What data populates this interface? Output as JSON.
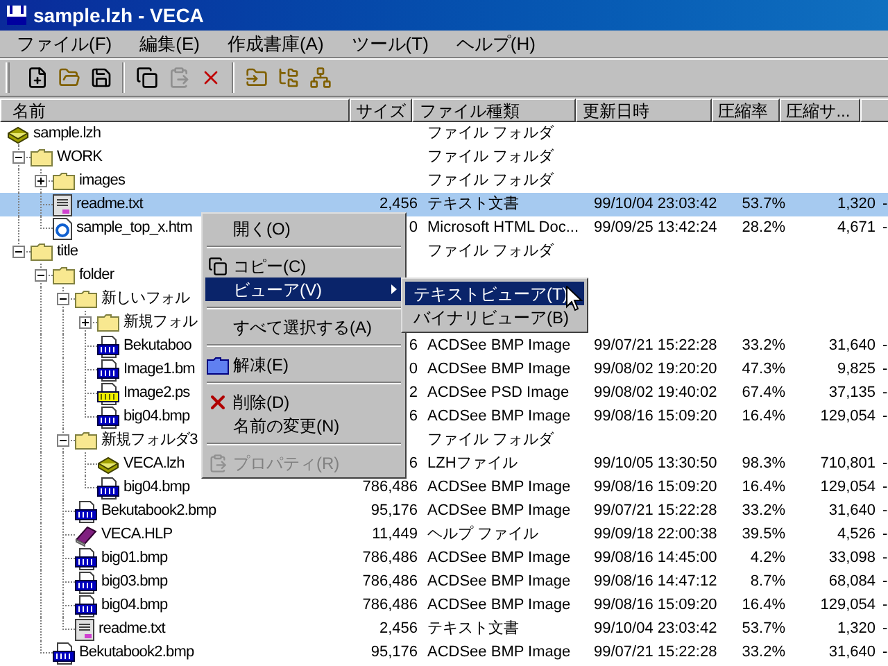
{
  "window": {
    "title": "sample.lzh - VECA"
  },
  "menu_bar": [
    "ファイル(F)",
    "編集(E)",
    "作成書庫(A)",
    "ツール(T)",
    "ヘルプ(H)"
  ],
  "toolbar": [
    {
      "kind": "new",
      "disabled": false
    },
    {
      "kind": "open",
      "disabled": false
    },
    {
      "kind": "save",
      "disabled": false
    },
    {
      "kind": "separator"
    },
    {
      "kind": "copy",
      "disabled": false
    },
    {
      "kind": "paste",
      "disabled": true
    },
    {
      "kind": "delete",
      "disabled": false
    },
    {
      "kind": "separator"
    },
    {
      "kind": "extract",
      "disabled": false
    },
    {
      "kind": "tree",
      "disabled": false
    },
    {
      "kind": "branch",
      "disabled": false
    }
  ],
  "columns": [
    "名前",
    "サイズ",
    "ファイル種類",
    "更新日時",
    "圧縮率",
    "圧縮サ..."
  ],
  "tree": [
    {
      "name": "sample.lzh",
      "kind": "archive",
      "selected": false,
      "type": "ファイル フォルダ",
      "children": [
        {
          "name": "WORK",
          "kind": "folder",
          "expanded": true,
          "selected": false,
          "type": "ファイル フォルダ",
          "children": [
            {
              "name": "images",
              "kind": "folder",
              "expanded": false,
              "selected": false,
              "type": "ファイル フォルダ"
            },
            {
              "name": "readme.txt",
              "kind": "text",
              "selected": true,
              "size": "2,456",
              "type": "テキスト文書",
              "date": "99/10/04 23:03:42",
              "ratio": "53.7%",
              "packed": "1,320",
              "column_8": "-"
            },
            {
              "name": "sample_top_x.htm",
              "kind": "html",
              "selected": false,
              "size": "0",
              "type": "Microsoft HTML Doc...",
              "date": "99/09/25 13:42:24",
              "ratio": "28.2%",
              "packed": "4,671",
              "column_8": "-"
            }
          ]
        },
        {
          "name": "title",
          "kind": "folder",
          "expanded": true,
          "selected": false,
          "type": "ファイル フォルダ",
          "children": [
            {
              "name": "folder",
              "kind": "folder",
              "expanded": true,
              "selected": false,
              "children": [
                {
                  "name": "新しいフォル",
                  "kind": "folder",
                  "expanded": true,
                  "selected": false,
                  "children": [
                    {
                      "name": "新規フォル",
                      "kind": "folder",
                      "expanded": false,
                      "selected": false
                    },
                    {
                      "name": "Bekutaboo",
                      "kind": "bmp",
                      "selected": false,
                      "size": "6",
                      "type": "ACDSee BMP Image",
                      "date": "99/07/21 15:22:28",
                      "ratio": "33.2%",
                      "packed": "31,640",
                      "column_8": "-"
                    },
                    {
                      "name": "Image1.bm",
                      "kind": "bmp",
                      "selected": false,
                      "size": "0",
                      "type": "ACDSee BMP Image",
                      "date": "99/08/02 19:20:20",
                      "ratio": "47.3%",
                      "packed": "9,825",
                      "column_8": "-"
                    },
                    {
                      "name": "Image2.ps",
                      "kind": "psd",
                      "selected": false,
                      "size": "2",
                      "type": "ACDSee PSD Image",
                      "date": "99/08/02 19:40:02",
                      "ratio": "67.4%",
                      "packed": "37,135",
                      "column_8": "-"
                    },
                    {
                      "name": "big04.bmp",
                      "kind": "bmp",
                      "selected": false,
                      "size": "6",
                      "type": "ACDSee BMP Image",
                      "date": "99/08/16 15:09:20",
                      "ratio": "16.4%",
                      "packed": "129,054",
                      "column_8": "-"
                    }
                  ]
                },
                {
                  "name": "新規フォルダ3",
                  "kind": "folder",
                  "expanded": true,
                  "selected": false,
                  "type": "ファイル フォルダ",
                  "children": [
                    {
                      "name": "VECA.lzh",
                      "kind": "archive",
                      "selected": false,
                      "size": "6",
                      "type": "LZHファイル",
                      "date": "99/10/05 13:30:50",
                      "ratio": "98.3%",
                      "packed": "710,801",
                      "column_8": "-"
                    },
                    {
                      "name": "big04.bmp",
                      "kind": "bmp",
                      "selected": false,
                      "size": "786,486",
                      "type": "ACDSee BMP Image",
                      "date": "99/08/16 15:09:20",
                      "ratio": "16.4%",
                      "packed": "129,054",
                      "column_8": "-"
                    }
                  ]
                },
                {
                  "name": "Bekutabook2.bmp",
                  "kind": "bmp",
                  "selected": false,
                  "size": "95,176",
                  "type": "ACDSee BMP Image",
                  "date": "99/07/21 15:22:28",
                  "ratio": "33.2%",
                  "packed": "31,640",
                  "column_8": "-"
                },
                {
                  "name": "VECA.HLP",
                  "kind": "help",
                  "selected": false,
                  "size": "11,449",
                  "type": "ヘルプ ファイル",
                  "date": "99/09/18 22:00:38",
                  "ratio": "39.5%",
                  "packed": "4,526",
                  "column_8": "-"
                },
                {
                  "name": "big01.bmp",
                  "kind": "bmp",
                  "selected": false,
                  "size": "786,486",
                  "type": "ACDSee BMP Image",
                  "date": "99/08/16 14:45:00",
                  "ratio": "4.2%",
                  "packed": "33,098",
                  "column_8": "-"
                },
                {
                  "name": "big03.bmp",
                  "kind": "bmp",
                  "selected": false,
                  "size": "786,486",
                  "type": "ACDSee BMP Image",
                  "date": "99/08/16 14:47:12",
                  "ratio": "8.7%",
                  "packed": "68,084",
                  "column_8": "-"
                },
                {
                  "name": "big04.bmp",
                  "kind": "bmp",
                  "selected": false,
                  "size": "786,486",
                  "type": "ACDSee BMP Image",
                  "date": "99/08/16 15:09:20",
                  "ratio": "16.4%",
                  "packed": "129,054",
                  "column_8": "-"
                },
                {
                  "name": "readme.txt",
                  "kind": "text",
                  "selected": false,
                  "size": "2,456",
                  "type": "テキスト文書",
                  "date": "99/10/04 23:03:42",
                  "ratio": "53.7%",
                  "packed": "1,320",
                  "column_8": "-"
                }
              ]
            },
            {
              "name": "Bekutabook2.bmp",
              "kind": "bmp",
              "selected": false,
              "size": "95,176",
              "type": "ACDSee BMP Image",
              "date": "99/07/21 15:22:28",
              "ratio": "33.2%",
              "packed": "31,640",
              "column_8": "-"
            }
          ]
        }
      ]
    }
  ],
  "context_menu": {
    "items": [
      {
        "kind": "plain",
        "label": "開く(O)",
        "highlighted": false,
        "disabled": false,
        "has_submenu": false
      },
      {
        "kind": "separator"
      },
      {
        "kind": "copy",
        "label": "コピー(C)",
        "highlighted": false,
        "disabled": false,
        "has_submenu": false
      },
      {
        "kind": "plain",
        "label": "ビューア(V)",
        "highlighted": true,
        "disabled": false,
        "has_submenu": true
      },
      {
        "kind": "separator"
      },
      {
        "kind": "plain",
        "label": "すべて選択する(A)",
        "highlighted": false,
        "disabled": false,
        "has_submenu": false
      },
      {
        "kind": "separator"
      },
      {
        "kind": "extract",
        "label": "解凍(E)",
        "highlighted": false,
        "disabled": false,
        "has_submenu": false
      },
      {
        "kind": "separator"
      },
      {
        "kind": "delete",
        "label": "削除(D)",
        "highlighted": false,
        "disabled": false,
        "has_submenu": false
      },
      {
        "kind": "plain",
        "label": "名前の変更(N)",
        "highlighted": false,
        "disabled": false,
        "has_submenu": false
      },
      {
        "kind": "separator"
      },
      {
        "kind": "properties",
        "label": "プロパティ(R)",
        "highlighted": false,
        "disabled": true,
        "has_submenu": false
      }
    ]
  },
  "submenu": {
    "items": [
      {
        "label": "テキストビューア(T)",
        "highlighted": true
      },
      {
        "label": "バイナリビューア(B)",
        "highlighted": false
      }
    ]
  }
}
